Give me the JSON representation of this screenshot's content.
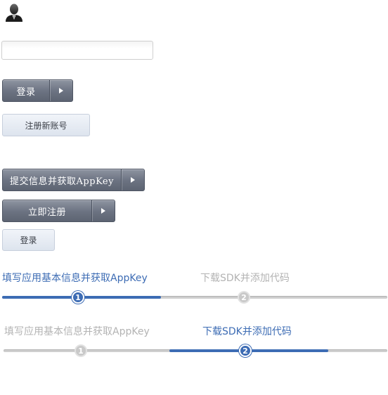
{
  "avatar": {
    "icon": "user-silhouette-icon"
  },
  "username_input": {
    "value": "",
    "placeholder": ""
  },
  "login_split": {
    "label": "登录",
    "icon": "play-triangle-icon"
  },
  "register_account": {
    "label": "注册新账号"
  },
  "submit_split": {
    "label": "提交信息并获取AppKey",
    "icon": "play-triangle-icon"
  },
  "register_now_split": {
    "label": "立即注册",
    "icon": "play-triangle-icon"
  },
  "login_light": {
    "label": "登录"
  },
  "steps_a": {
    "step1": {
      "label": "填写应用基本信息并获取AppKey",
      "number": "1",
      "state": "active"
    },
    "step2": {
      "label": "下载SDK并添加代码",
      "number": "2",
      "state": "inactive"
    }
  },
  "steps_b": {
    "step1": {
      "label": "填写应用基本信息并获取AppKey",
      "number": "1",
      "state": "inactive"
    },
    "step2": {
      "label": "下载SDK并添加代码",
      "number": "2",
      "state": "active"
    }
  },
  "colors": {
    "accent": "#3d6cb4",
    "inactive": "#b3b3b3",
    "button_dark": "#6b7281",
    "button_light": "#e6ebf3"
  }
}
